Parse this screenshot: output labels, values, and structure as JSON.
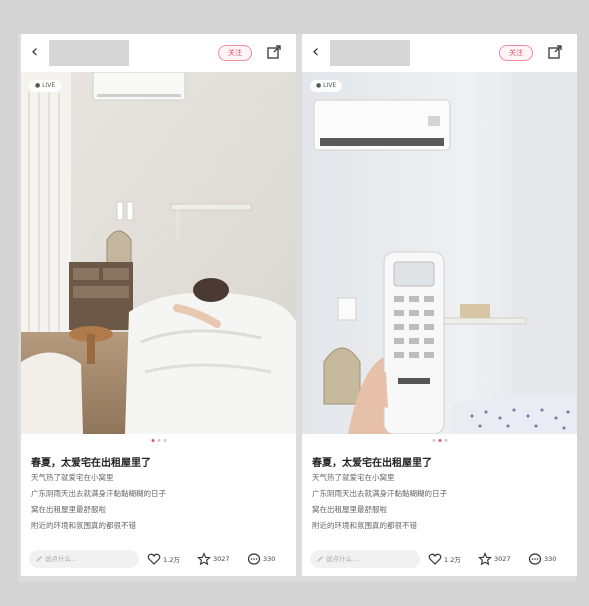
{
  "posts": [
    {
      "follow_label": "关注",
      "live_label": "● LIVE",
      "title": "春夏，太爱宅在出租屋里了",
      "lines": [
        "天气热了就爱宅在小窝里",
        "广东阴雨天出去就满身汗黏黏糊糊的日子",
        "窝在出租屋里最舒服啦",
        "附近的环境和氛围真的都很不错"
      ],
      "comment_placeholder": "说点什么...",
      "likes": "1.2万",
      "stars": "3027",
      "comments": "330"
    },
    {
      "follow_label": "关注",
      "live_label": "● LIVE",
      "title": "春夏，太爱宅在出租屋里了",
      "lines": [
        "天气热了就爱宅在小窝里",
        "广东阴雨天出去就满身汗黏黏糊糊的日子",
        "窝在出租屋里最舒服啦",
        "附近的环境和氛围真的都很不错"
      ],
      "comment_placeholder": "说点什么...",
      "likes": "1.2万",
      "stars": "3027",
      "comments": "330"
    }
  ],
  "colors": {
    "accent": "#e8506d",
    "background": "#d4d4d4"
  },
  "icons": [
    "back-icon",
    "share-icon",
    "pencil-icon",
    "heart-icon",
    "star-icon",
    "comment-icon"
  ]
}
